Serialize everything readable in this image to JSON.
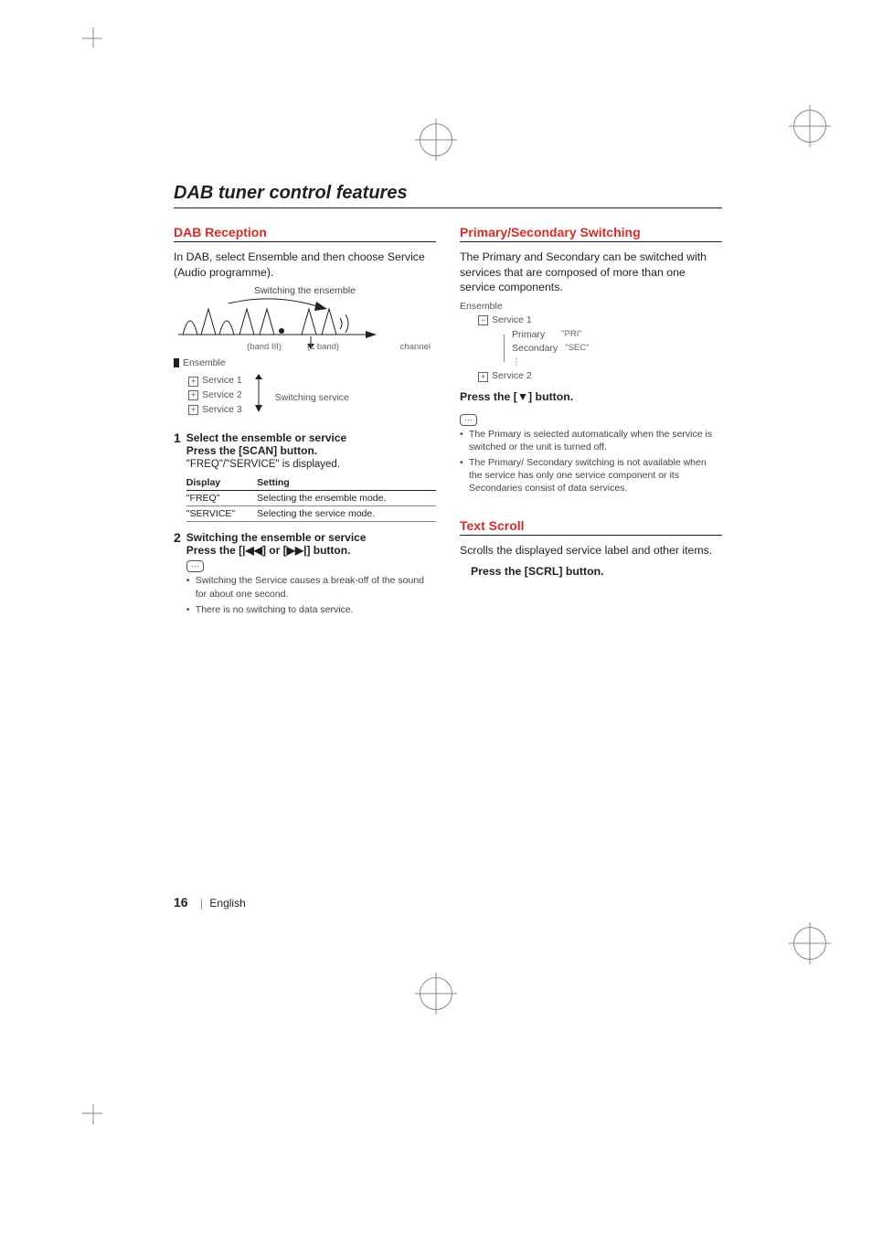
{
  "title": "DAB tuner control features",
  "footer": {
    "page": "16",
    "sep": "|",
    "lang": "English"
  },
  "left": {
    "heading": "DAB Reception",
    "intro": "In DAB, select Ensemble and then choose Service (Audio programme).",
    "diagram": {
      "switch_label": "Switching the ensemble",
      "channel": "channel",
      "band3": "(band III)",
      "lband": "(L band)",
      "ensemble": "Ensemble",
      "s1": "Service 1",
      "s2": "Service 2",
      "s3": "Service 3",
      "switch_service": "Switching service"
    },
    "step1": {
      "num": "1",
      "title": "Select the ensemble or service",
      "sub": "Press the [SCAN] button.",
      "text": "\"FREQ\"/\"SERVICE\" is displayed."
    },
    "table": {
      "h1": "Display",
      "h2": "Setting",
      "r1c1": "\"FREQ\"",
      "r1c2": "Selecting the ensemble mode.",
      "r2c1": "\"SERVICE\"",
      "r2c2": "Selecting the service mode."
    },
    "step2": {
      "num": "2",
      "title": "Switching the ensemble or service",
      "sub": "Press the [|◀◀] or [▶▶|] button."
    },
    "notes": {
      "n1": "Switching the Service causes a break-off of the sound for about one second.",
      "n2": "There is no switching to data service."
    }
  },
  "right": {
    "sec1": {
      "heading": "Primary/Secondary Switching",
      "intro": "The Primary and Secondary can be switched with services that are composed of more than one service components.",
      "ensemble": "Ensemble",
      "s1": "Service 1",
      "primary": "Primary",
      "secondary": "Secondary",
      "pri_q": "\"PRI\"",
      "sec_q": "\"SEC\"",
      "dots": "⋮",
      "s2": "Service 2",
      "press": "Press the [▼] button.",
      "note1": "The Primary is selected automatically when the service is switched or the unit is turned off.",
      "note2": "The Primary/ Secondary switching is not available when the service has only one service component or its Secondaries consist of data services."
    },
    "sec2": {
      "heading": "Text Scroll",
      "intro": "Scrolls the displayed service label and other items.",
      "press": "Press the [SCRL] button."
    }
  }
}
